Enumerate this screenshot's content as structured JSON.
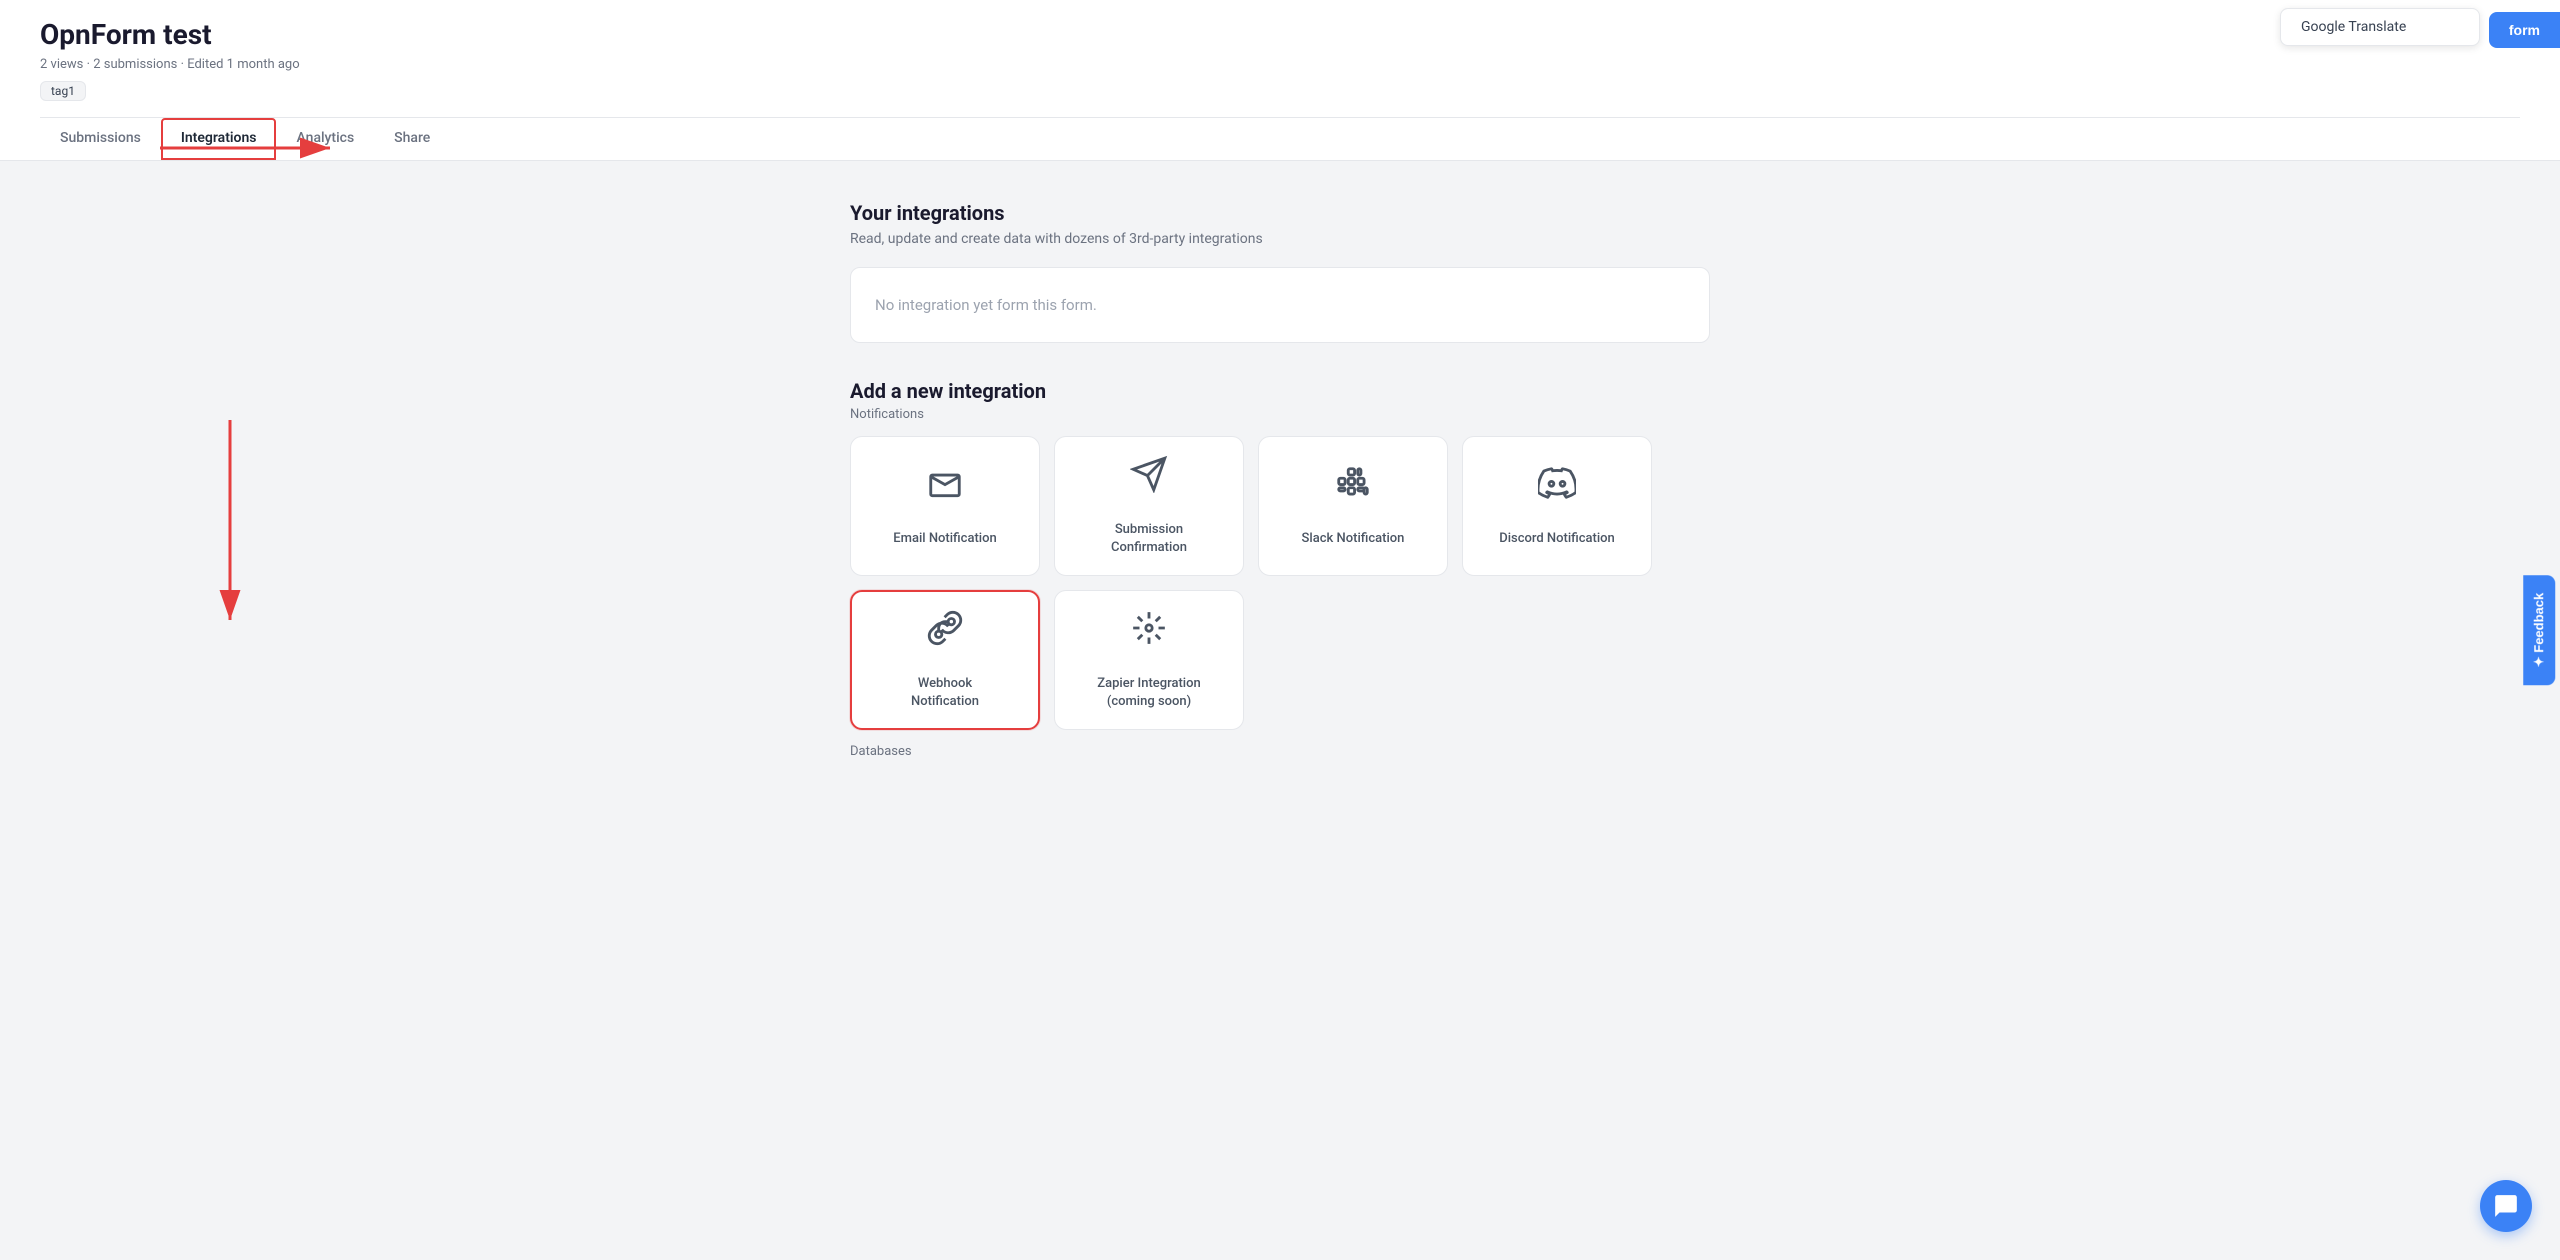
{
  "header": {
    "title": "OpnForm test",
    "meta": "2 views · 2 submissions · Edited 1 month ago",
    "tag": "tag1",
    "edit_button": "form",
    "google_translate": "Google Translate"
  },
  "nav": {
    "tabs": [
      {
        "id": "submissions",
        "label": "Submissions",
        "active": false
      },
      {
        "id": "integrations",
        "label": "Integrations",
        "active": true
      },
      {
        "id": "analytics",
        "label": "Analytics",
        "active": false
      },
      {
        "id": "share",
        "label": "Share",
        "active": false
      }
    ]
  },
  "integrations_section": {
    "title": "Your integrations",
    "subtitle": "Read, update and create data with dozens of 3rd-party integrations",
    "empty_message": "No integration yet form this form."
  },
  "add_integration": {
    "title": "Add a new integration",
    "notifications_label": "Notifications",
    "cards": [
      {
        "id": "email",
        "label": "Email Notification",
        "icon": "email"
      },
      {
        "id": "submission",
        "label": "Submission Confirmation",
        "icon": "submission"
      },
      {
        "id": "slack",
        "label": "Slack Notification",
        "icon": "slack"
      },
      {
        "id": "discord",
        "label": "Discord Notification",
        "icon": "discord"
      },
      {
        "id": "webhook",
        "label": "Webhook Notification",
        "icon": "webhook",
        "highlighted": true
      },
      {
        "id": "zapier",
        "label": "Zapier Integration (coming soon)",
        "icon": "zapier"
      }
    ],
    "databases_label": "Databases"
  },
  "feedback_btn": "✦ Feedback",
  "colors": {
    "accent": "#3b82f6",
    "red_highlight": "#e53e3e",
    "text_dark": "#1a1a2e",
    "text_muted": "#6b7280",
    "border": "#e5e7eb",
    "card_icon": "#4b5563"
  }
}
